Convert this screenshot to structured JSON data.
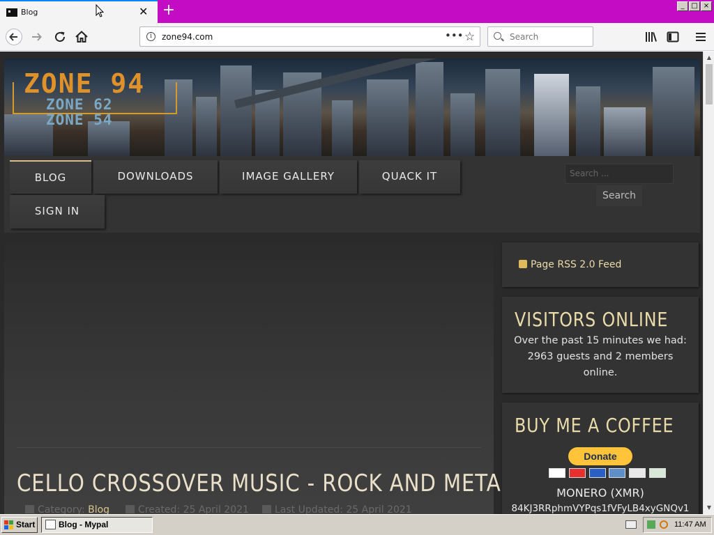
{
  "browser": {
    "tab_title": "Blog",
    "url": "zone94.com",
    "search_placeholder": "Search",
    "new_tab_symbol": "+",
    "window_controls": [
      "_",
      "□",
      "×"
    ]
  },
  "site": {
    "logo_main": "ZONE 94",
    "logo_sub": [
      "ZONE 62",
      "ZONE 54"
    ],
    "menu": [
      "BLOG",
      "DOWNLOADS",
      "IMAGE GALLERY",
      "QUACK IT",
      "SIGN IN"
    ],
    "active_menu": "BLOG",
    "search_placeholder": "Search ...",
    "search_button": "Search"
  },
  "article": {
    "title": "CELLO CROSSOVER MUSIC - ROCK AND METAL",
    "category_label": "Category:",
    "category": "Blog",
    "created": "Created: 25 April 2021",
    "updated": "Last Updated: 25 April 2021"
  },
  "sidebar": {
    "rss_label": "Page RSS 2.0 Feed",
    "visitors_title": "VISITORS ONLINE",
    "visitors_text": "Over the past 15 minutes we had: 2963 guests and 2 members online.",
    "coffee_title": "BUY ME A COFFEE",
    "donate_label": "Donate",
    "monero_label": "MONERO (XMR)",
    "monero_address": "84KJ3RRphmVYPqs1fVFyLB4xyGNQv1"
  },
  "taskbar": {
    "start_label": "Start",
    "task_label": "Blog - Mypal",
    "clock": "11:47 AM"
  },
  "colors": {
    "tabstrip": "#c40cc4",
    "accent_text": "#eadcaa",
    "logo_orange": "#e0922a",
    "donate_yellow": "#ffc439"
  }
}
